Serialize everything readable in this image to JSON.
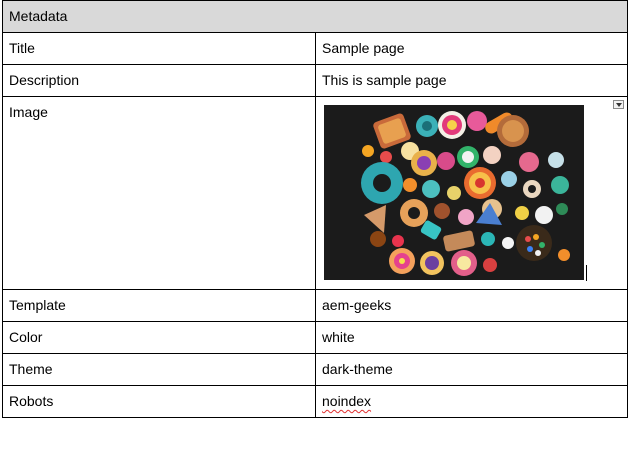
{
  "table": {
    "header": "Metadata",
    "rows": {
      "title": {
        "key": "Title",
        "value": "Sample page"
      },
      "description": {
        "key": "Description",
        "value": "This is sample page"
      },
      "image": {
        "key": "Image"
      },
      "template": {
        "key": "Template",
        "value": "aem-geeks"
      },
      "color": {
        "key": "Color",
        "value": "white"
      },
      "theme": {
        "key": "Theme",
        "value": "dark-theme"
      },
      "robots": {
        "key": "Robots",
        "value": "noindex"
      }
    }
  },
  "image": {
    "subject": "colorful candy assortment photo",
    "background_color": "#1b1b1b"
  },
  "icons": {
    "image_options": "chevron-down-icon"
  },
  "colors": {
    "header_bg": "#d9d9d9",
    "border": "#000000",
    "spellcheck_underline": "#e03030"
  }
}
